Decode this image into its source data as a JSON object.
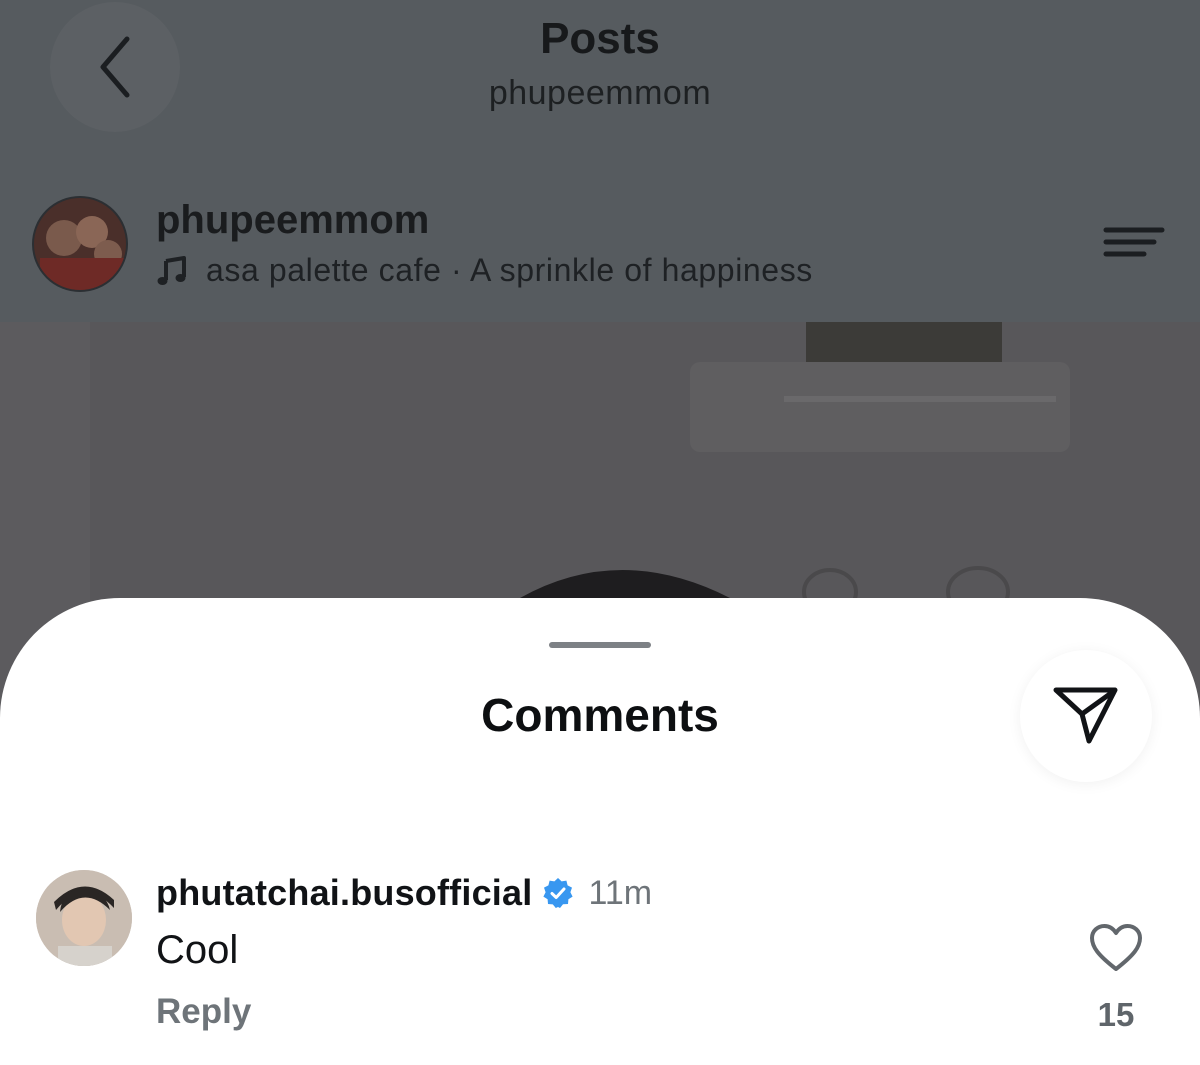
{
  "header": {
    "title": "Posts",
    "subtitle": "phupeemmom"
  },
  "post": {
    "author": "phupeemmom",
    "music_line": "asa palette cafe · A sprinkle of happiness"
  },
  "sheet": {
    "title": "Comments"
  },
  "comment": {
    "user": "phutatchai.busofficial",
    "time": "11m",
    "text": "Cool",
    "reply_label": "Reply",
    "like_count": "15",
    "verified": true
  },
  "icons": {
    "back": "chevron-left-icon",
    "music": "music-note-icon",
    "menu": "menu-icon",
    "share": "send-icon",
    "verified": "verified-badge-icon",
    "like": "heart-icon"
  },
  "colors": {
    "overlay": "#565b5f",
    "sheet_bg": "#ffffff",
    "verified_blue": "#3897f0",
    "secondary_text": "#6e7479"
  }
}
